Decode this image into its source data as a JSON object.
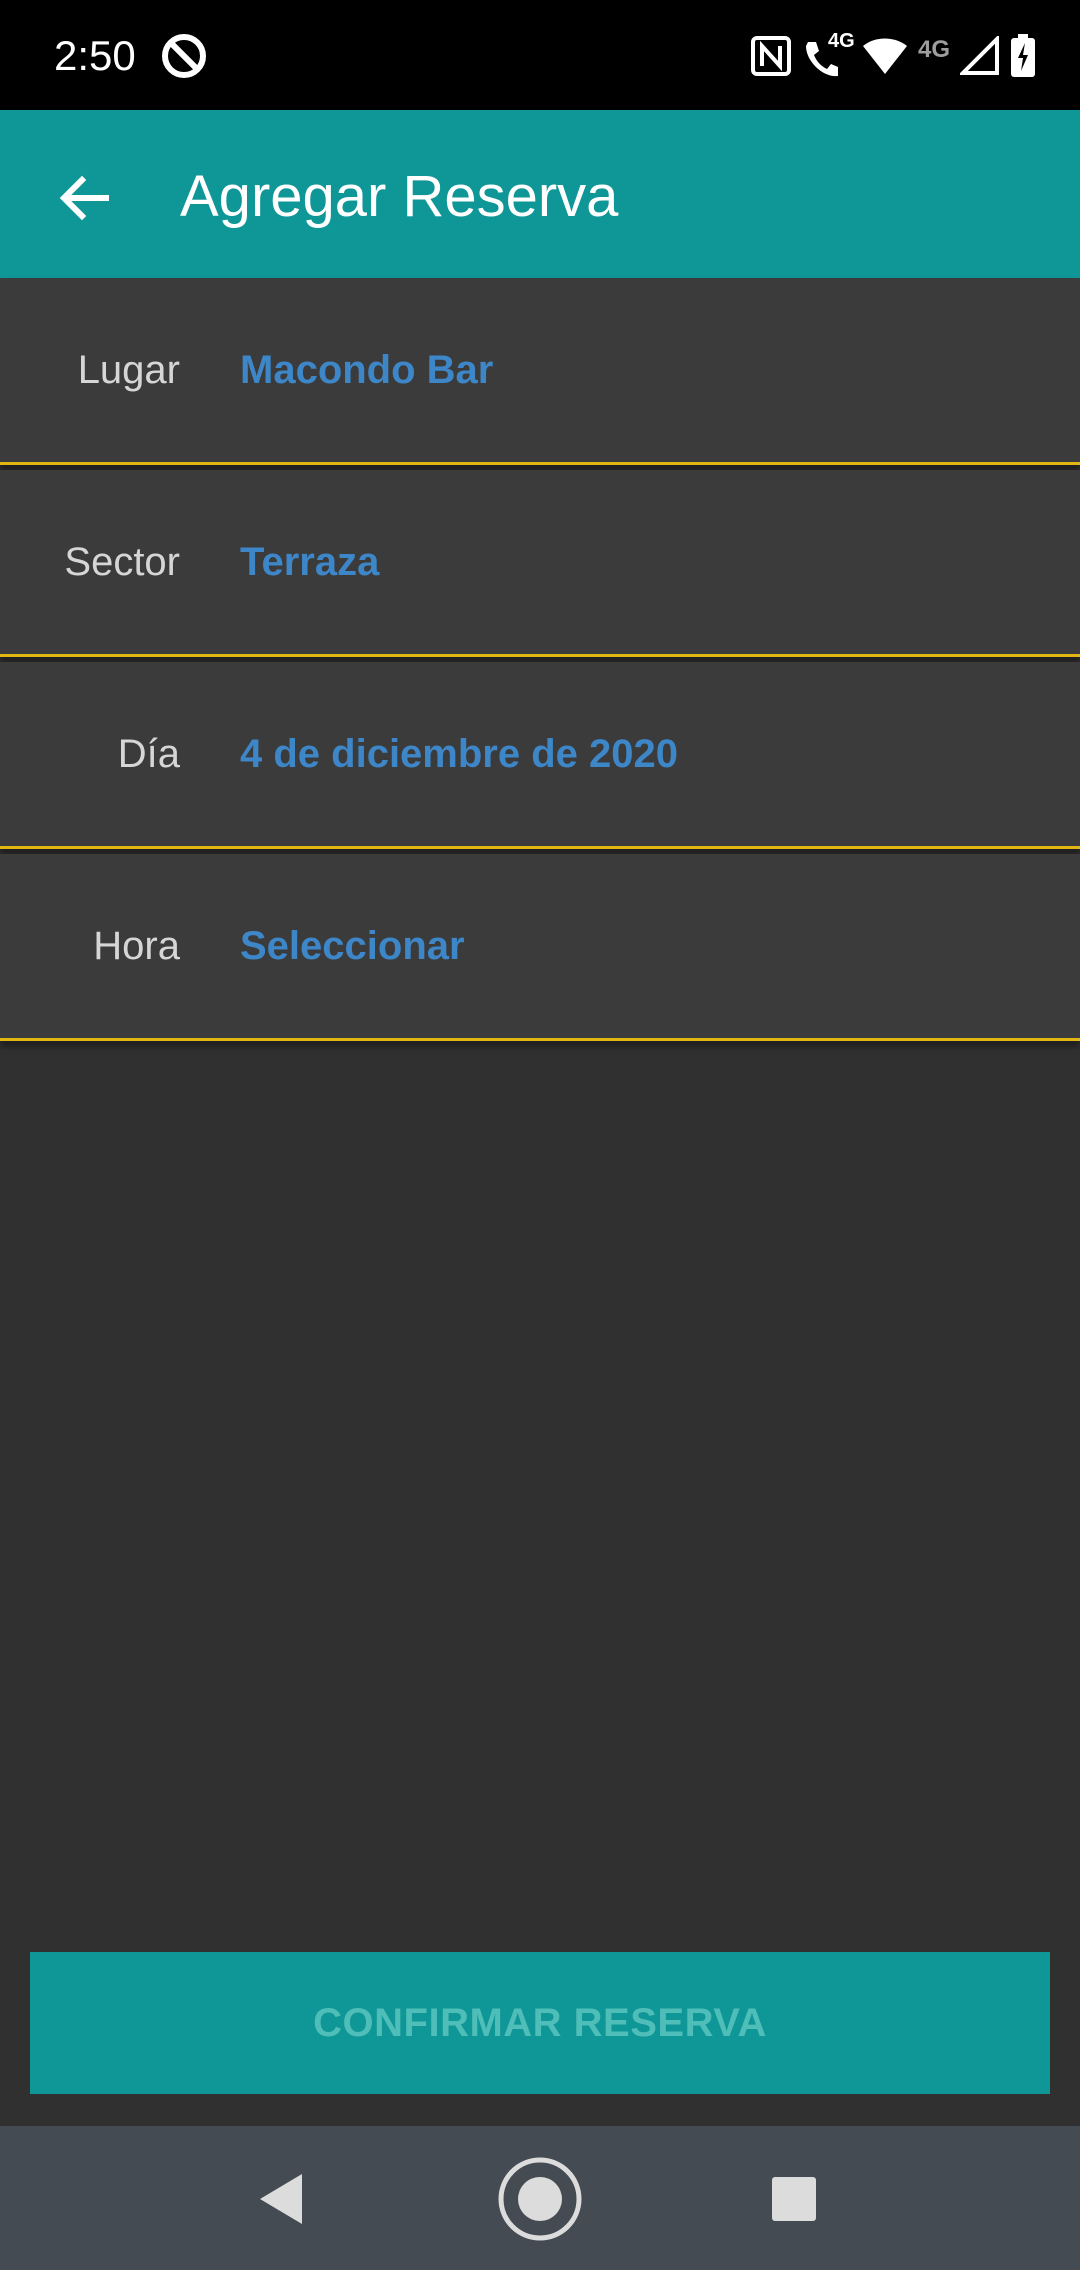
{
  "status_bar": {
    "time": "2:50",
    "left_icon": "data-saver-icon",
    "right_icons": [
      "nfc-icon",
      "wifi-calling-icon",
      "wifi-icon",
      "signal-icon",
      "battery-charging-icon"
    ],
    "wifi_call_label": "4G",
    "network_label": "4G"
  },
  "app_bar": {
    "back_icon": "arrow-back-icon",
    "title": "Agregar Reserva",
    "color": "#0f9696"
  },
  "form": {
    "rows": [
      {
        "label": "Lugar",
        "value": "Macondo Bar"
      },
      {
        "label": "Sector",
        "value": "Terraza"
      },
      {
        "label": "Día",
        "value": "4 de diciembre de 2020"
      },
      {
        "label": "Hora",
        "value": "Seleccionar"
      }
    ],
    "value_color": "#3d86c8",
    "divider_color": "#e2b714"
  },
  "confirm_button": {
    "label": "CONFIRMAR RESERVA"
  },
  "nav_bar": {
    "items": [
      "back-triangle-icon",
      "home-circle-icon",
      "recents-square-icon"
    ]
  }
}
